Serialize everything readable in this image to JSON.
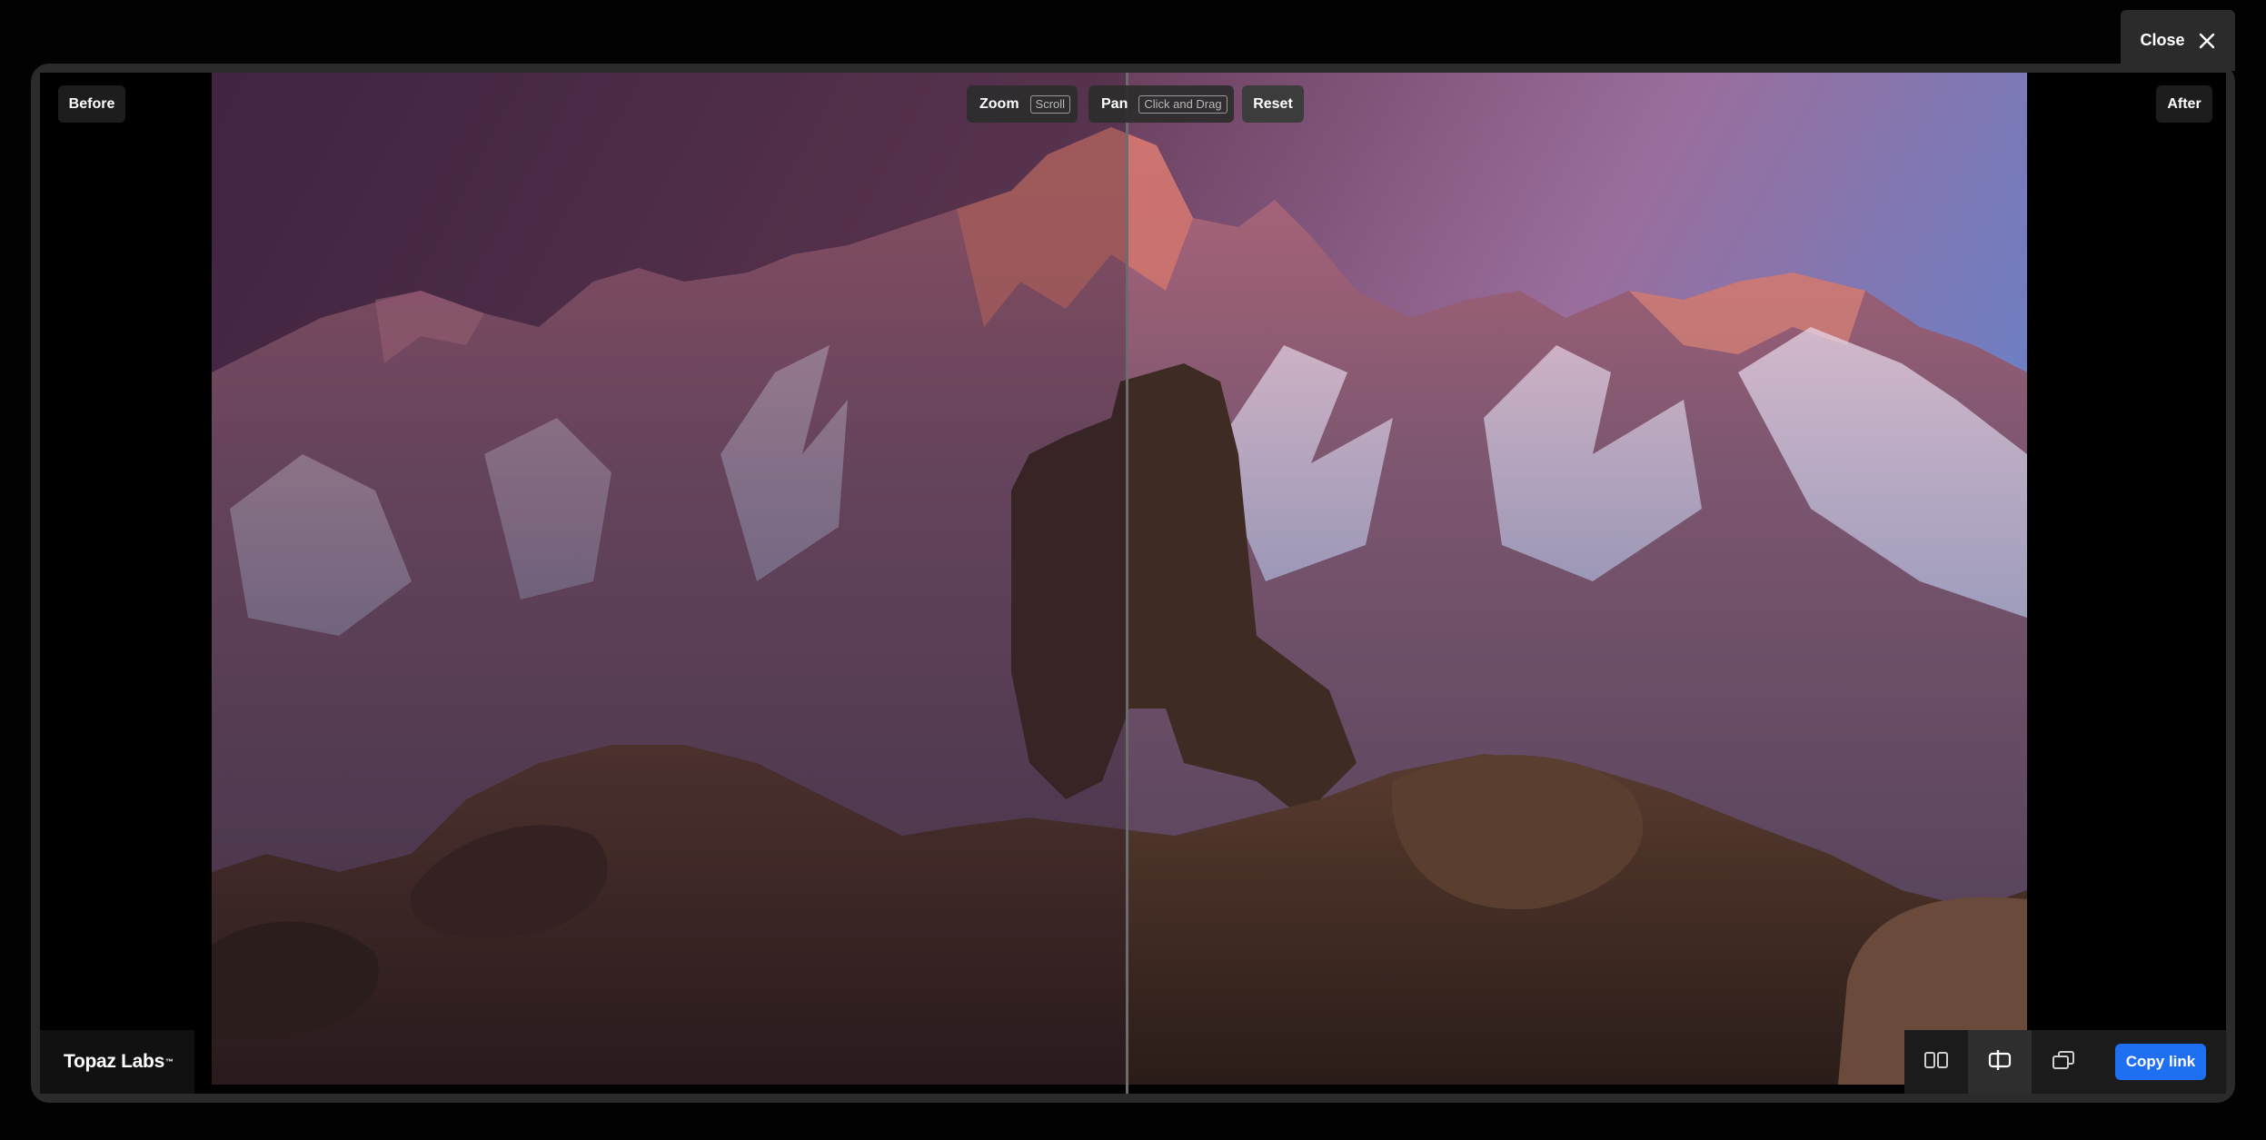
{
  "close": {
    "label": "Close",
    "icon": "close-icon"
  },
  "labels": {
    "before": "Before",
    "after": "After"
  },
  "hints": {
    "zoom_label": "Zoom",
    "zoom_key": "Scroll",
    "pan_label": "Pan",
    "pan_key": "Click and Drag"
  },
  "reset_label": "Reset",
  "brand": {
    "name": "Topaz Labs",
    "trademark": "™"
  },
  "toolbar": {
    "buttons": [
      {
        "icon": "side-by-side-view-icon",
        "active": false
      },
      {
        "icon": "split-slider-view-icon",
        "active": true
      },
      {
        "icon": "overlay-view-icon",
        "active": false
      }
    ],
    "copy_label": "Copy link"
  },
  "colors": {
    "accent": "#1f6ff2",
    "frame": "#2b2b2b",
    "background": "#020202"
  }
}
